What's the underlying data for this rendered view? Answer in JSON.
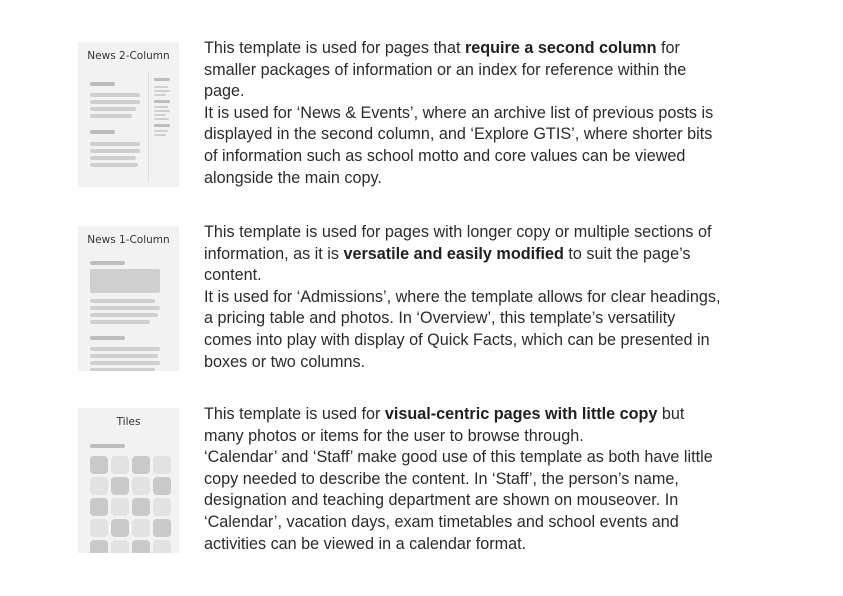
{
  "templates": [
    {
      "thumb_title": "News 2-Column",
      "para1": {
        "pre": "This template is used for pages that ",
        "bold": "require a second column",
        "post": " for smaller packages of information or an index for reference within the page."
      },
      "para2": "It is used for ‘News & Events’, where an archive list of previous posts is displayed in the second column, and ‘Explore GTIS’, where shorter bits of information such as school motto and core values can be viewed alongside the main copy."
    },
    {
      "thumb_title": "News 1-Column",
      "para1": {
        "pre": "This template is used for pages with longer copy or multiple sections of information, as it is ",
        "bold": "versatile and easily modified",
        "post": " to suit the page’s content."
      },
      "para2": "It is used for ‘Admissions’, where the template allows for clear headings, a pricing  table and photos. In ‘Overview’, this template’s versatility comes into play with display of Quick Facts, which can be presented in boxes or two columns."
    },
    {
      "thumb_title": "Tiles",
      "para1": {
        "pre": "This template is used for ",
        "bold": "visual-centric pages with little copy",
        "post": " but many photos or items for the user to browse through."
      },
      "para2": "‘Calendar’ and ‘Staff’ make good use of this template as both have little copy needed to describe the content. In ‘Staff’, the person’s name, designation and teaching department are shown on mouseover. In ‘Calendar’, vacation days, exam timetables and school events and activities can be viewed in a calendar format."
    }
  ]
}
